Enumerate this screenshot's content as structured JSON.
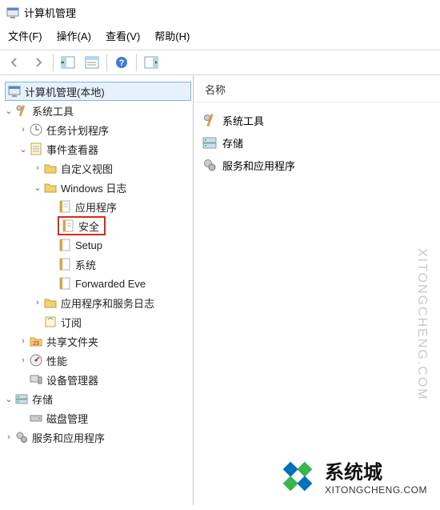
{
  "window": {
    "title": "计算机管理"
  },
  "menu": {
    "file": "文件(F)",
    "action": "操作(A)",
    "view": "查看(V)",
    "help": "帮助(H)"
  },
  "leftHeader": "计算机管理(本地)",
  "rightHeader": "名称",
  "tree": {
    "root": "计算机管理(本地)",
    "systemTools": "系统工具",
    "taskScheduler": "任务计划程序",
    "eventViewer": "事件查看器",
    "customViews": "自定义视图",
    "windowsLogs": "Windows 日志",
    "application": "应用程序",
    "security": "安全",
    "setup": "Setup",
    "system": "系统",
    "forwarded": "Forwarded Eve",
    "appServiceLogs": "应用程序和服务日志",
    "subscriptions": "订阅",
    "sharedFolders": "共享文件夹",
    "performance": "性能",
    "deviceManager": "设备管理器",
    "storage": "存储",
    "diskMgmt": "磁盘管理",
    "servicesApps": "服务和应用程序"
  },
  "list": {
    "systemTools": "系统工具",
    "storage": "存储",
    "servicesApps": "服务和应用程序"
  },
  "watermark": "XITONGCHENG.COM",
  "brand": {
    "title": "系统城",
    "sub": "XITONGCHENG.COM"
  }
}
